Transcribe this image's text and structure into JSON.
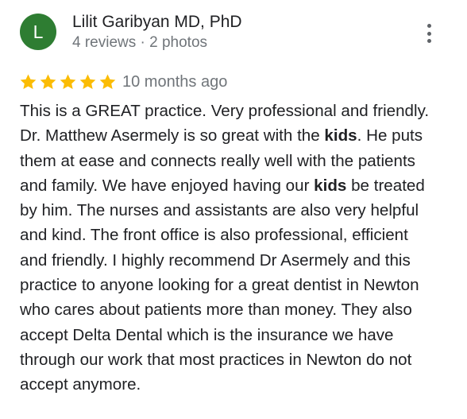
{
  "author": {
    "initial": "L",
    "name": "Lilit Garibyan MD, PhD",
    "meta": "4 reviews · 2 photos"
  },
  "colors": {
    "avatar_bg": "#2e7d32",
    "star": "#fbbc04",
    "secondary_text": "#70757a"
  },
  "icons": {
    "more": "more-vert-icon",
    "star": "star-icon"
  },
  "review": {
    "rating": 5,
    "rating_max": 5,
    "date": "10 months ago",
    "segments": [
      {
        "text": "This is a GREAT practice. Very professional and friendly.\nDr. Matthew Asermely is so great with the ",
        "bold": false
      },
      {
        "text": "kids",
        "bold": true
      },
      {
        "text": ". He puts\nthem at ease and connects really well with the patients\nand family. We have enjoyed having our ",
        "bold": false
      },
      {
        "text": "kids",
        "bold": true
      },
      {
        "text": " be treated\nby him. The nurses and assistants are also very helpful\nand kind. The front office is also professional, efficient\nand friendly. I highly recommend Dr Asermely and this\npractice to anyone looking for a great dentist in Newton\nwho cares about patients more than money. They also\naccept Delta Dental which is the insurance we have\nthrough our work that most practices in Newton do not\naccept anymore.",
        "bold": false
      }
    ]
  }
}
